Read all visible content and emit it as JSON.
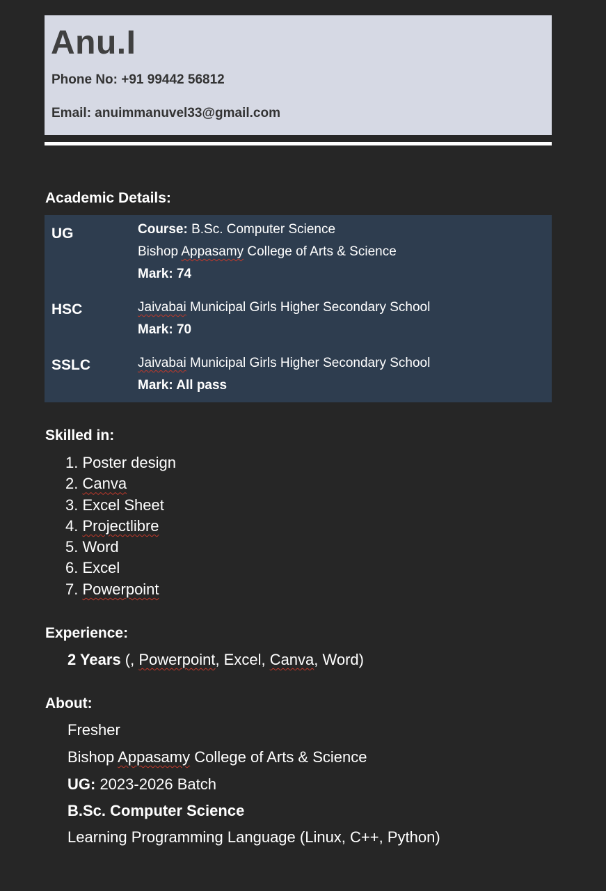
{
  "header": {
    "name": "Anu.I",
    "phone": "Phone No: +91 99442 56812",
    "email": "Email: anuimmanuvel33@gmail.com"
  },
  "academic": {
    "title": "Academic Details:",
    "rows": [
      {
        "level": "UG",
        "course_label": "Course:",
        "course_value": " B.Sc. Computer Science",
        "institution_pre": "Bishop ",
        "institution_flag": "Appasamy",
        "institution_post": " College of Arts & Science",
        "mark": "Mark: 74"
      },
      {
        "level": "HSC",
        "institution_flag": "Jaivabai",
        "institution_post": " Municipal Girls Higher Secondary School",
        "mark": "Mark: 70"
      },
      {
        "level": "SSLC",
        "institution_flag": "Jaivabai",
        "institution_post": " Municipal Girls Higher Secondary School",
        "mark": "Mark: All pass"
      }
    ]
  },
  "skills": {
    "title": "Skilled in:",
    "items": [
      {
        "num": "1. ",
        "text": "Poster design"
      },
      {
        "num": "2. ",
        "text": "Canva"
      },
      {
        "num": "3. ",
        "text": "Excel Sheet"
      },
      {
        "num": "4. ",
        "text": "Projectlibre"
      },
      {
        "num": "5. ",
        "text": "Word"
      },
      {
        "num": "6. ",
        "text": "Excel"
      },
      {
        "num": "7. ",
        "text": "Powerpoint"
      }
    ]
  },
  "experience": {
    "title": "Experience:",
    "years": "2 Years",
    "open": " (, ",
    "item1": "Powerpoint",
    "sep1": ", Excel, ",
    "item2": "Canva",
    "close": ", Word)"
  },
  "about": {
    "title": "About:",
    "line1": "Fresher",
    "line2_pre": "Bishop ",
    "line2_flag": "Appasamy",
    "line2_post": " College of Arts & Science",
    "line3_label": "UG:",
    "line3_value": " 2023-2026 Batch",
    "line4": "B.Sc. Computer Science",
    "line5": "Learning Programming Language (Linux, C++, Python)"
  }
}
